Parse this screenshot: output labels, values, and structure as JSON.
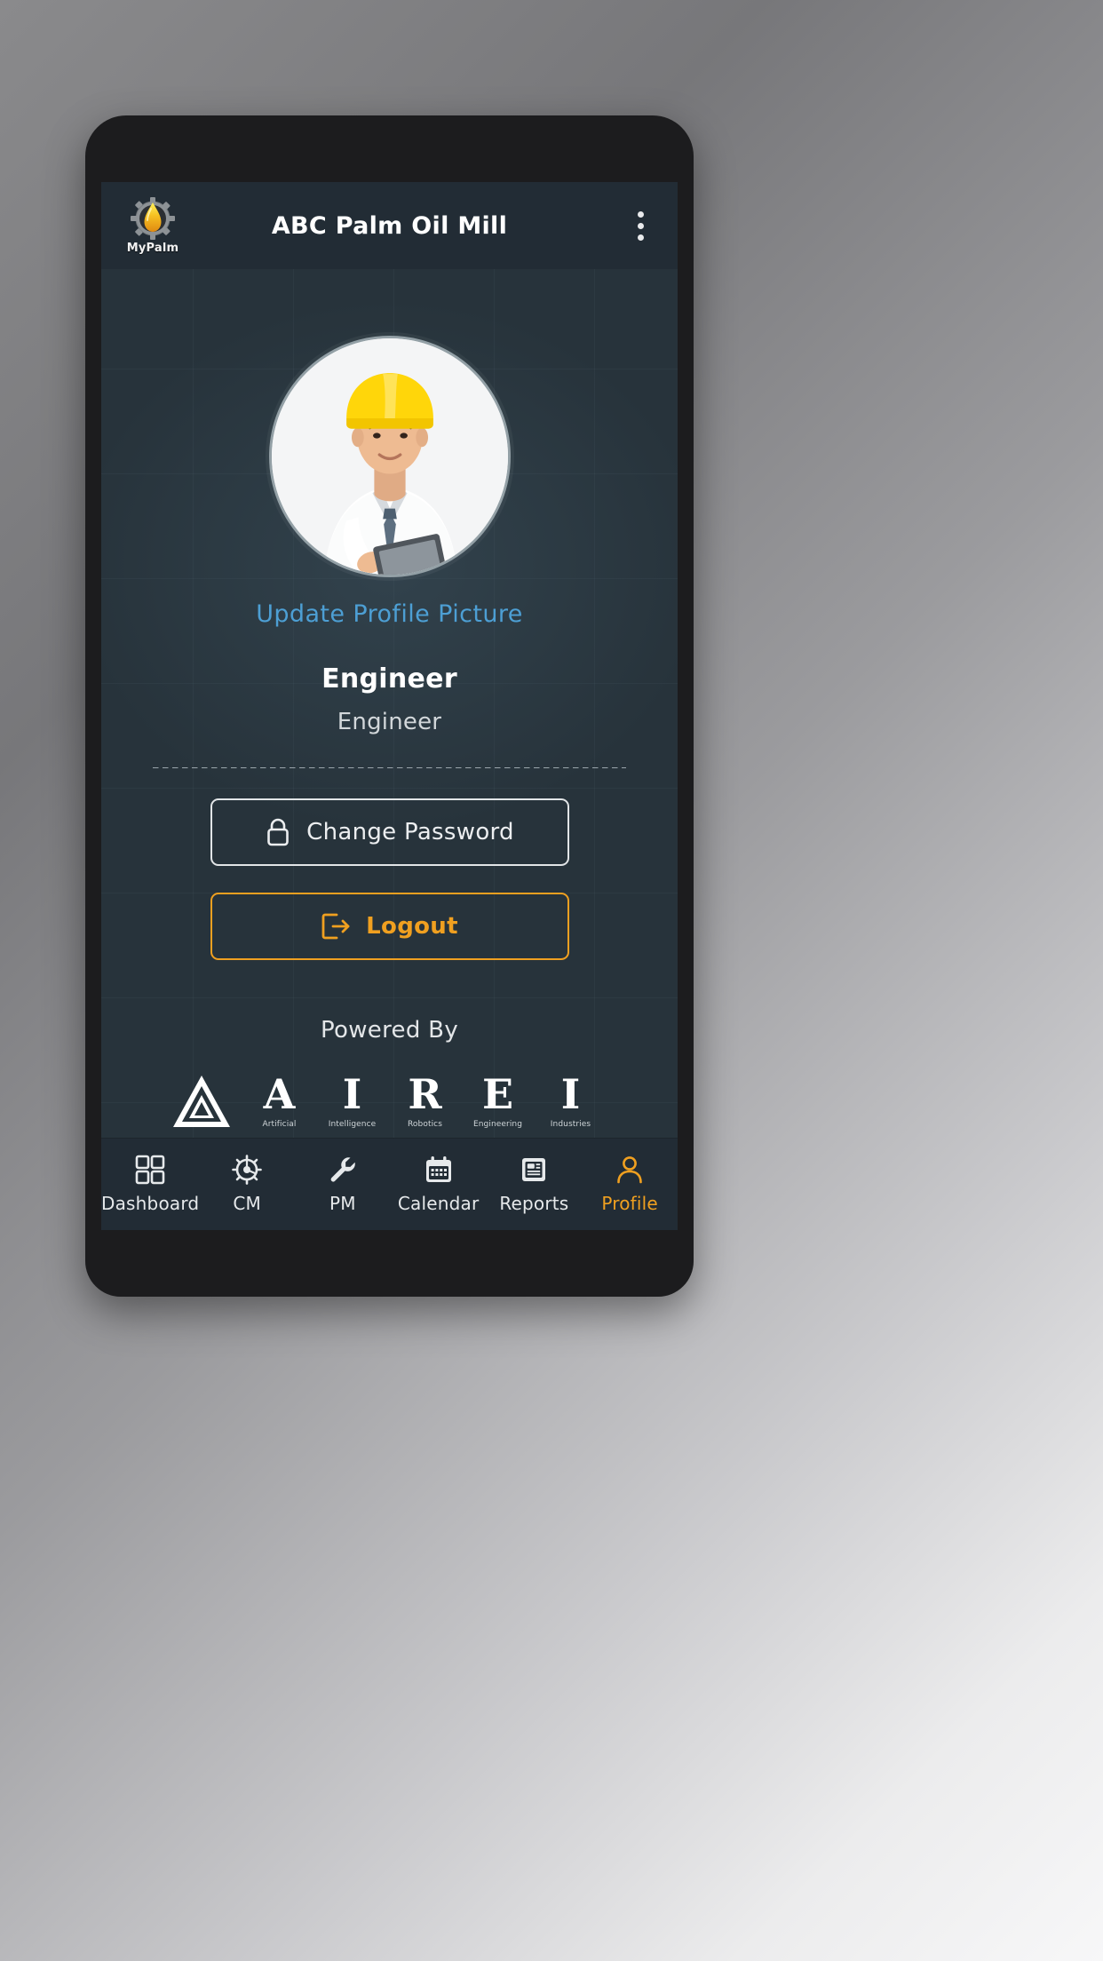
{
  "header": {
    "brand_name": "MyPalm",
    "brand_icon": "palm-oil-droplet-gear-logo",
    "title": "ABC Palm Oil Mill",
    "menu_icon": "kebab-menu-icon"
  },
  "profile": {
    "avatar_icon": "engineer-portrait-avatar",
    "update_link": "Update Profile Picture",
    "name": "Engineer",
    "role": "Engineer"
  },
  "actions": {
    "change_password": {
      "label": "Change Password",
      "icon": "lock-icon"
    },
    "logout": {
      "label": "Logout",
      "icon": "logout-arrow-icon"
    }
  },
  "footer": {
    "powered_by": "Powered By",
    "logo_mark": "airei-triangle-logo",
    "letters": [
      {
        "letter": "A",
        "sub": "Artificial"
      },
      {
        "letter": "I",
        "sub": "Intelligence"
      },
      {
        "letter": "R",
        "sub": "Robotics"
      },
      {
        "letter": "E",
        "sub": "Engineering"
      },
      {
        "letter": "I",
        "sub": "Industries"
      }
    ]
  },
  "bottom_nav": {
    "items": [
      {
        "label": "Dashboard",
        "icon": "grid-icon",
        "active": false
      },
      {
        "label": "CM",
        "icon": "gear-icon",
        "active": false
      },
      {
        "label": "PM",
        "icon": "wrench-icon",
        "active": false
      },
      {
        "label": "Calendar",
        "icon": "calendar-icon",
        "active": false
      },
      {
        "label": "Reports",
        "icon": "report-document-icon",
        "active": false
      },
      {
        "label": "Profile",
        "icon": "person-icon",
        "active": true
      }
    ]
  },
  "colors": {
    "accent_amber": "#f0a020",
    "link_blue": "#4d9fd4",
    "appbar_bg": "#222c35",
    "screen_bg": "#27333b"
  }
}
